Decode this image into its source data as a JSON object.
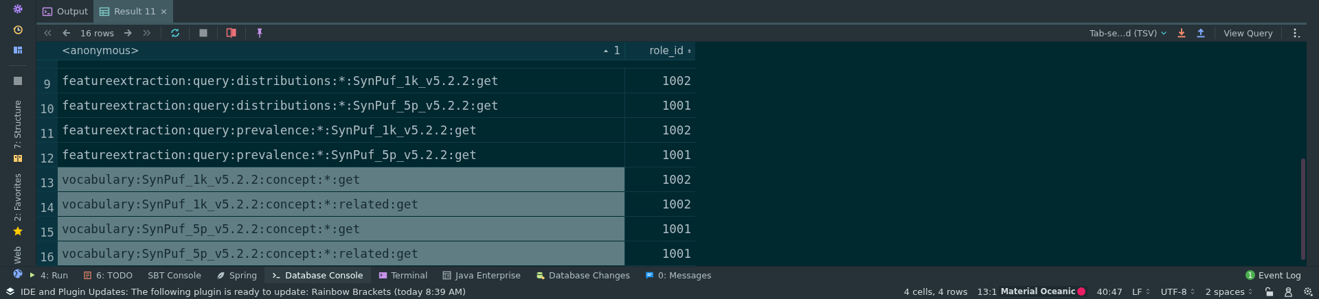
{
  "tool_windows": [
    {
      "label": "7: Structure"
    },
    {
      "label": "2: Favorites"
    },
    {
      "label": "Web"
    }
  ],
  "tabs": [
    {
      "label": "Output",
      "selected": false
    },
    {
      "label": "Result 11",
      "selected": true,
      "close": "×"
    }
  ],
  "toolbar": {
    "row_count": "16 rows",
    "export_format": "Tab-se…d (TSV)",
    "view_query": "View Query"
  },
  "table": {
    "columns": [
      {
        "label": "<anonymous>",
        "sort_order": "1"
      },
      {
        "label": "role_id"
      }
    ],
    "rows": [
      {
        "number": "9",
        "name": "featureextraction:query:distributions:*:SynPuf_1k_v5.2.2:get",
        "role_id": "1002",
        "selected": false
      },
      {
        "number": "10",
        "name": "featureextraction:query:distributions:*:SynPuf_5p_v5.2.2:get",
        "role_id": "1001",
        "selected": false
      },
      {
        "number": "11",
        "name": "featureextraction:query:prevalence:*:SynPuf_1k_v5.2.2:get",
        "role_id": "1002",
        "selected": false
      },
      {
        "number": "12",
        "name": "featureextraction:query:prevalence:*:SynPuf_5p_v5.2.2:get",
        "role_id": "1001",
        "selected": false
      },
      {
        "number": "13",
        "name": "vocabulary:SynPuf_1k_v5.2.2:concept:*:get",
        "role_id": "1002",
        "selected": true
      },
      {
        "number": "14",
        "name": "vocabulary:SynPuf_1k_v5.2.2:concept:*:related:get",
        "role_id": "1002",
        "selected": true
      },
      {
        "number": "15",
        "name": "vocabulary:SynPuf_5p_v5.2.2:concept:*:get",
        "role_id": "1001",
        "selected": true
      },
      {
        "number": "16",
        "name": "vocabulary:SynPuf_5p_v5.2.2:concept:*:related:get",
        "role_id": "1001",
        "selected": true
      }
    ]
  },
  "bottom_tabs": [
    {
      "label": "4: Run",
      "selected": false
    },
    {
      "label": "6: TODO",
      "selected": false
    },
    {
      "label": "SBT Console",
      "selected": false
    },
    {
      "label": "Spring",
      "selected": false
    },
    {
      "label": "Database Console",
      "selected": true
    },
    {
      "label": "Terminal",
      "selected": false
    },
    {
      "label": "Java Enterprise",
      "selected": false
    },
    {
      "label": "Database Changes",
      "selected": false
    },
    {
      "label": "0: Messages",
      "selected": false
    }
  ],
  "event_log": {
    "badge": "1",
    "label": "Event Log"
  },
  "status_bar": {
    "message": "IDE and Plugin Updates: The following plugin is ready to update: Rainbow Brackets (today 8:39 AM)",
    "selection": "4 cells, 4 rows",
    "caret": "13:1",
    "theme": "Material Oceanic",
    "position": "40:47",
    "line_separator": "LF",
    "encoding": "UTF-8",
    "indent": "2 spaces"
  }
}
